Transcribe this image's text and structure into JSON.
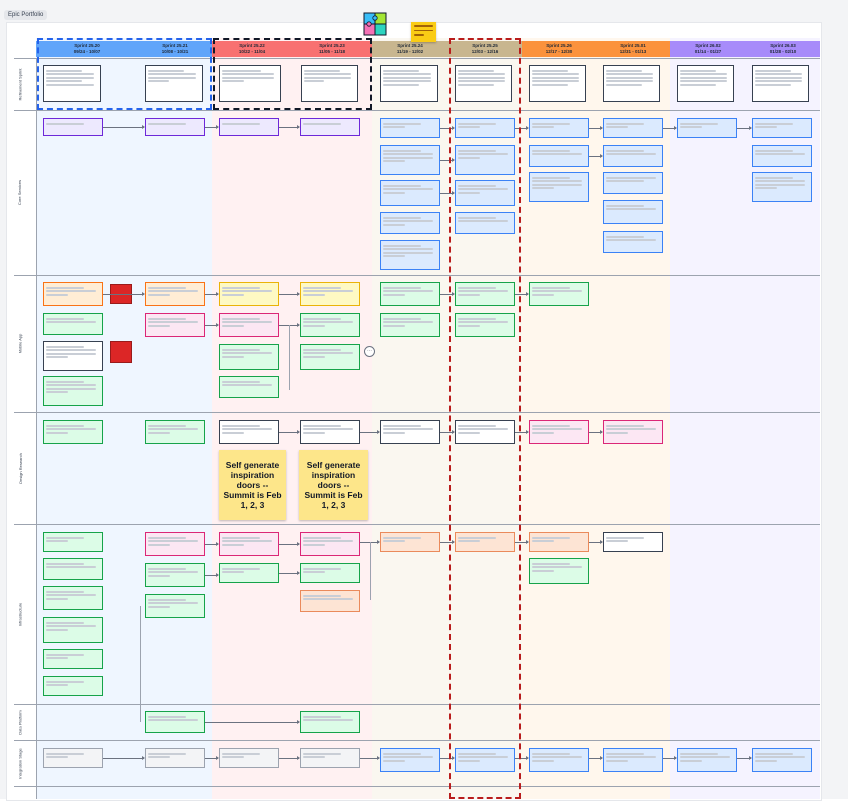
{
  "board": {
    "tab_label": "Epic Portfolio",
    "colors": {
      "col_blue": "#60a5fa",
      "col_red": "#f87171",
      "col_tan": "#c8b68f",
      "col_orange": "#fb923c",
      "col_purple": "#a78bfa",
      "dashed_blue": "#2563eb",
      "dashed_black": "#111827",
      "dashed_red": "#b91c1c"
    }
  },
  "columns": [
    {
      "name": "Sprint 25.20",
      "dates": "09/24 - 10/07"
    },
    {
      "name": "Sprint 25.21",
      "dates": "10/08 - 10/21"
    },
    {
      "name": "Sprint 25.22",
      "dates": "10/22 - 11/04"
    },
    {
      "name": "Sprint 25.23",
      "dates": "11/05 - 11/18"
    },
    {
      "name": "Sprint 25.24",
      "dates": "11/19 - 12/02"
    },
    {
      "name": "Sprint 25.25",
      "dates": "12/03 - 12/16"
    },
    {
      "name": "Sprint 25.26",
      "dates": "12/17 - 12/30"
    },
    {
      "name": "Sprint 25.01",
      "dates": "12/31 - 01/13"
    },
    {
      "name": "Sprint 26.02",
      "dates": "01/14 - 01/27"
    },
    {
      "name": "Sprint 26.03",
      "dates": "01/28 - 02/10"
    }
  ],
  "lanes": [
    {
      "label": "Refinement Sprint"
    },
    {
      "label": "Core Services"
    },
    {
      "label": "Mobile App"
    },
    {
      "label": "Design Research"
    },
    {
      "label": "Infrastructure"
    },
    {
      "label": "Data Platform"
    },
    {
      "label": "Integration Stage"
    }
  ],
  "notes": [
    {
      "text": "Self generate inspiration doors -- Summit is Feb 1, 2, 3"
    },
    {
      "text": "Self generate inspiration doors -- Summit is Feb 1, 2, 3"
    }
  ],
  "icons": {
    "puzzle": "puzzle-icon",
    "more": "ellipsis-icon"
  }
}
